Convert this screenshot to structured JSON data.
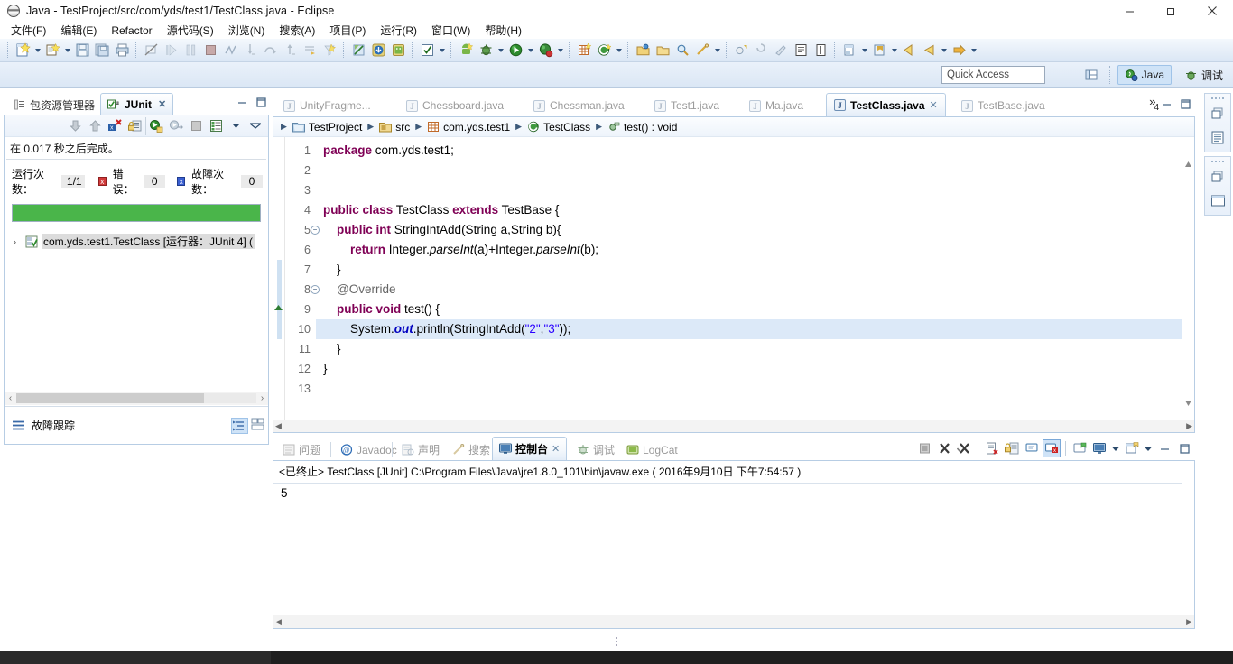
{
  "window": {
    "title": "Java  -  TestProject/src/com/yds/test1/TestClass.java  -  Eclipse",
    "icon": "eclipse-icon",
    "minimize": "minimize-icon",
    "maximize": "maximize-icon",
    "close": "close-icon"
  },
  "menubar": {
    "items": [
      {
        "label": "文件(F)",
        "mnemonic": "F"
      },
      {
        "label": "编辑(E)",
        "mnemonic": "E"
      },
      {
        "label": "Refactor",
        "mnemonic": ""
      },
      {
        "label": "源代码(S)",
        "mnemonic": "S"
      },
      {
        "label": "浏览(N)",
        "mnemonic": "N"
      },
      {
        "label": "搜索(A)",
        "mnemonic": "A"
      },
      {
        "label": "项目(P)",
        "mnemonic": "P"
      },
      {
        "label": "运行(R)",
        "mnemonic": "R"
      },
      {
        "label": "窗口(W)",
        "mnemonic": "W"
      },
      {
        "label": "帮助(H)",
        "mnemonic": "H"
      }
    ]
  },
  "toolbar": {
    "icons": [
      "new-wizard-icon",
      "new-dropdown-arrow",
      "new-java-class-icon",
      "class-dropdown-arrow",
      "save-icon",
      "save-all-icon",
      "print-icon",
      "sep",
      "toggle-markoccurrences-icon",
      "resume-icon",
      "suspend-icon",
      "terminate-icon",
      "disconnect-icon",
      "step-into-icon",
      "step-over-icon",
      "step-return-icon",
      "run-to-line-icon",
      "use-step-filters-icon",
      "sep",
      "skip-breakpoints-icon",
      "export-icon",
      "android-sdk-manager-icon",
      "sep",
      "check-icon",
      "check-dropdown-arrow",
      "sep",
      "new-android-icon",
      "debug-icon",
      "debug-dropdown-arrow",
      "run-icon",
      "run-dropdown-arrow",
      "coverage-icon",
      "coverage-dropdown-arrow",
      "sep",
      "new-java-project-icon",
      "new-android-project-icon",
      "project-dropdown-arrow",
      "sep",
      "open-type-icon",
      "open-resource-icon",
      "search-icon",
      "search2-icon",
      "search-dropdown-arrow",
      "sep",
      "next-annotation-icon",
      "previous-annotation-icon",
      "last-edit-icon",
      "toggle-block-selection-icon",
      "toggle-word-wrap-icon",
      "sep",
      "new-untitled-text-file-icon",
      "file-dropdown-arrow",
      "pin-editor-icon",
      "pin-dropdown-arrow",
      "back-icon",
      "back2-icon",
      "back-dropdown-arrow",
      "forward-icon",
      "forward-dropdown-arrow"
    ]
  },
  "perspective": {
    "quick_access_placeholder": "Quick Access",
    "new_perspective_icon": "open-perspective-icon",
    "tabs": [
      {
        "label": "Java",
        "icon": "java-perspective-icon",
        "active": true
      },
      {
        "label": "调试",
        "icon": "debug-perspective-icon",
        "active": false
      }
    ]
  },
  "left_view": {
    "tabs": [
      {
        "label": "包资源管理器",
        "icon": "package-explorer-icon",
        "active": false,
        "closable": false
      },
      {
        "label": "JUnit",
        "icon": "junit-icon",
        "active": true,
        "closable": true
      }
    ],
    "minimize_icon": "minimize-view-icon",
    "maximize_icon": "maximize-view-icon",
    "junit": {
      "toolbar_icons": [
        "next-failure-icon",
        "previous-failure-icon",
        "show-failures-only-icon",
        "lock-scroll-icon",
        "rerun-test-icon",
        "rerun-failed-icon",
        "stop-test-icon",
        "test-history-icon",
        "view-menu-arrow-icon",
        "view-menu-icon"
      ],
      "status": "在 0.017 秒之后完成。",
      "counts": [
        {
          "label": "运行次数：",
          "value": "1/1",
          "marker": "none"
        },
        {
          "label": "错误：",
          "value": "0",
          "marker": "error"
        },
        {
          "label": "故障次数：",
          "value": "0",
          "marker": "failure"
        }
      ],
      "progress_percent": 100,
      "progress_color": "#4ab54a",
      "tree": [
        {
          "label": "com.yds.test1.TestClass [运行器：JUnit 4] (",
          "icon": "test-suite-ok-icon",
          "expander": "›"
        }
      ],
      "failure_trace_label": "故障跟踪",
      "failure_trace_icon": "failure-trace-icon",
      "failure_trace_buttons": [
        "filter-stack-trace-icon",
        "compare-result-icon"
      ]
    }
  },
  "editor": {
    "tabs": [
      {
        "label": "UnityFragme...",
        "active": false
      },
      {
        "label": "Chessboard.java",
        "active": false
      },
      {
        "label": "Chessman.java",
        "active": false
      },
      {
        "label": "Test1.java",
        "active": false
      },
      {
        "label": "Ma.java",
        "active": false
      },
      {
        "label": "TestClass.java",
        "active": true
      },
      {
        "label": "TestBase.java",
        "active": false
      }
    ],
    "overflow_label": "»",
    "overflow_count": "4",
    "minimize_icon": "minimize-view-icon",
    "maximize_icon": "maximize-view-icon",
    "breadcrumb": [
      {
        "label": "TestProject",
        "icon": "project-icon"
      },
      {
        "label": "src",
        "icon": "source-folder-icon"
      },
      {
        "label": "com.yds.test1",
        "icon": "package-icon"
      },
      {
        "label": "TestClass",
        "icon": "class-icon"
      },
      {
        "label": "test() : void",
        "icon": "method-icon"
      }
    ],
    "lines": [
      {
        "n": "1",
        "fold": false,
        "highlight": false
      },
      {
        "n": "2",
        "fold": false,
        "highlight": false
      },
      {
        "n": "3",
        "fold": false,
        "highlight": false
      },
      {
        "n": "4",
        "fold": false,
        "highlight": false
      },
      {
        "n": "5",
        "fold": true,
        "highlight": false
      },
      {
        "n": "6",
        "fold": false,
        "highlight": false
      },
      {
        "n": "7",
        "fold": false,
        "highlight": false
      },
      {
        "n": "8",
        "fold": true,
        "highlight": false
      },
      {
        "n": "9",
        "fold": false,
        "highlight": false
      },
      {
        "n": "10",
        "fold": false,
        "highlight": true
      },
      {
        "n": "11",
        "fold": false,
        "highlight": false
      },
      {
        "n": "12",
        "fold": false,
        "highlight": false
      },
      {
        "n": "13",
        "fold": false,
        "highlight": false
      }
    ],
    "code_text": [
      "package com.yds.test1;",
      "",
      "",
      "public class TestClass extends TestBase {",
      "    public int StringIntAdd(String a,String b){",
      "        return Integer.parseInt(a)+Integer.parseInt(b);",
      "    }",
      "    @Override",
      "    public void test() {",
      "        System.out.println(StringIntAdd(\"2\",\"3\"));",
      "    }",
      "}",
      ""
    ]
  },
  "console": {
    "tabs": [
      {
        "label": "问题",
        "icon": "problems-icon",
        "active": false,
        "closable": false
      },
      {
        "label": "Javadoc",
        "icon": "javadoc-icon",
        "active": false,
        "closable": false
      },
      {
        "label": "声明",
        "icon": "declaration-icon",
        "active": false,
        "closable": false
      },
      {
        "label": "搜索",
        "icon": "search-view-icon",
        "active": false,
        "closable": false
      },
      {
        "label": "控制台",
        "icon": "console-icon",
        "active": true,
        "closable": true
      },
      {
        "label": "调试",
        "icon": "debug-view-icon",
        "active": false,
        "closable": false
      },
      {
        "label": "LogCat",
        "icon": "logcat-icon",
        "active": false,
        "closable": false
      }
    ],
    "toolbar_icons": [
      "terminate-icon",
      "remove-launch-icon",
      "remove-all-terminated-icon",
      "sep",
      "clear-console-icon",
      "scroll-lock-icon",
      "show-console-on-output-icon",
      "show-console-on-error-icon",
      "sep",
      "pin-console-icon",
      "display-selected-console-icon",
      "display-console-arrow-icon",
      "open-console-icon",
      "open-console-arrow-icon",
      "minimize-view-icon",
      "maximize-view-icon"
    ],
    "header": "<已终止> TestClass [JUnit] C:\\Program Files\\Java\\jre1.8.0_101\\bin\\javaw.exe ( 2016年9月10日 下午7:54:57 )",
    "output": "5"
  },
  "fastview": {
    "groups": [
      {
        "icons": [
          "restore-view-icon",
          "outline-view-icon"
        ]
      },
      {
        "icons": [
          "restore-view-icon",
          "console-view-icon"
        ]
      }
    ]
  },
  "colors": {
    "accent": "#cfe3f7",
    "tab_border": "#b7cde4",
    "toolbar_gradient_top": "#f4f8fd",
    "toolbar_gradient_bottom": "#dbe7f5",
    "progress_green": "#4ab54a",
    "keyword_purple": "#7f0055",
    "string_blue": "#2a00ff",
    "static_field_blue": "#0000c0",
    "comment_gray": "#646464",
    "selection_blue": "#dce9f8"
  }
}
